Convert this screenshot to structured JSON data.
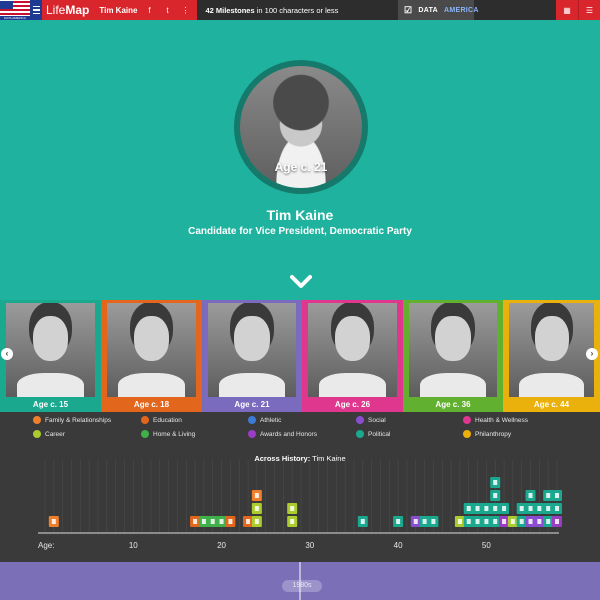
{
  "topbar": {
    "flag_caption": "DATA AMERICA",
    "logo_light": "Life",
    "logo_bold": "Map",
    "person": "Tim Kaine",
    "social": [
      "f",
      "t",
      "⋮"
    ],
    "milestones_bold": "42 Milestones",
    "milestones_rest": " in 100 characters or less",
    "data_label": "DATA",
    "america_label": "AMERICA",
    "grid_icon": "grid-icon",
    "menu_icon": "menu-icon"
  },
  "hero": {
    "age": "Age c. 21",
    "name": "Tim Kaine",
    "subtitle": "Candidate for Vice President, Democratic Party"
  },
  "strip": [
    {
      "age": "Age c. 15",
      "color": "#1aa88f"
    },
    {
      "age": "Age c. 18",
      "color": "#e2661c"
    },
    {
      "age": "Age c. 21",
      "color": "#7a6bbf"
    },
    {
      "age": "Age c. 26",
      "color": "#e0378e"
    },
    {
      "age": "Age c. 36",
      "color": "#62b02f"
    },
    {
      "age": "Age c. 44",
      "color": "#eab10d"
    }
  ],
  "legend": [
    {
      "label": "Family & Relationships",
      "color": "#f07f2c"
    },
    {
      "label": "Education",
      "color": "#e2661c"
    },
    {
      "label": "Athletic",
      "color": "#3d7ad6"
    },
    {
      "label": "Social",
      "color": "#8a4dd0"
    },
    {
      "label": "Health & Wellness",
      "color": "#e0378e"
    },
    {
      "label": "Career",
      "color": "#aacc2d"
    },
    {
      "label": "Home & Living",
      "color": "#3fb04a"
    },
    {
      "label": "Awards and Honors",
      "color": "#9b3cc4"
    },
    {
      "label": "Political",
      "color": "#1aa88f"
    },
    {
      "label": "Philanthropy",
      "color": "#eab10d"
    }
  ],
  "chart": {
    "title_bold": "Across History:",
    "title_rest": " Tim Kaine",
    "age_label": "Age:",
    "ticks": [
      "10",
      "20",
      "30",
      "40",
      "50"
    ]
  },
  "chart_data": {
    "type": "scatter",
    "title": "Across History: Tim Kaine",
    "xlabel": "Age:",
    "xlim": [
      0,
      58
    ],
    "xticks": [
      10,
      20,
      30,
      40,
      50
    ],
    "stacks": [
      {
        "age": 1,
        "cats": [
          "family"
        ]
      },
      {
        "age": 17,
        "cats": [
          "education"
        ]
      },
      {
        "age": 18,
        "cats": [
          "home"
        ]
      },
      {
        "age": 19,
        "cats": [
          "home"
        ]
      },
      {
        "age": 20,
        "cats": [
          "home"
        ]
      },
      {
        "age": 21,
        "cats": [
          "education"
        ]
      },
      {
        "age": 23,
        "cats": [
          "education"
        ]
      },
      {
        "age": 24,
        "cats": [
          "career",
          "career",
          "family"
        ]
      },
      {
        "age": 28,
        "cats": [
          "career",
          "career"
        ]
      },
      {
        "age": 36,
        "cats": [
          "political"
        ]
      },
      {
        "age": 40,
        "cats": [
          "political"
        ]
      },
      {
        "age": 42,
        "cats": [
          "social"
        ]
      },
      {
        "age": 43,
        "cats": [
          "political"
        ]
      },
      {
        "age": 44,
        "cats": [
          "political"
        ]
      },
      {
        "age": 47,
        "cats": [
          "career"
        ]
      },
      {
        "age": 48,
        "cats": [
          "political",
          "political"
        ]
      },
      {
        "age": 49,
        "cats": [
          "political",
          "political"
        ]
      },
      {
        "age": 50,
        "cats": [
          "political",
          "political"
        ]
      },
      {
        "age": 51,
        "cats": [
          "political",
          "political",
          "political",
          "political"
        ]
      },
      {
        "age": 52,
        "cats": [
          "awards",
          "political"
        ]
      },
      {
        "age": 53,
        "cats": [
          "career"
        ]
      },
      {
        "age": 54,
        "cats": [
          "political",
          "political"
        ]
      },
      {
        "age": 55,
        "cats": [
          "social",
          "political",
          "political"
        ]
      },
      {
        "age": 56,
        "cats": [
          "social",
          "political"
        ]
      },
      {
        "age": 57,
        "cats": [
          "political",
          "political",
          "political"
        ]
      },
      {
        "age": 58,
        "cats": [
          "awards",
          "political",
          "political"
        ]
      }
    ]
  },
  "colors": {
    "family": "#f07f2c",
    "education": "#e2661c",
    "home": "#3fb04a",
    "career": "#aacc2d",
    "political": "#1aa88f",
    "social": "#8a4dd0",
    "awards": "#9b3cc4"
  },
  "timeline": {
    "knob_label": "1980s"
  }
}
